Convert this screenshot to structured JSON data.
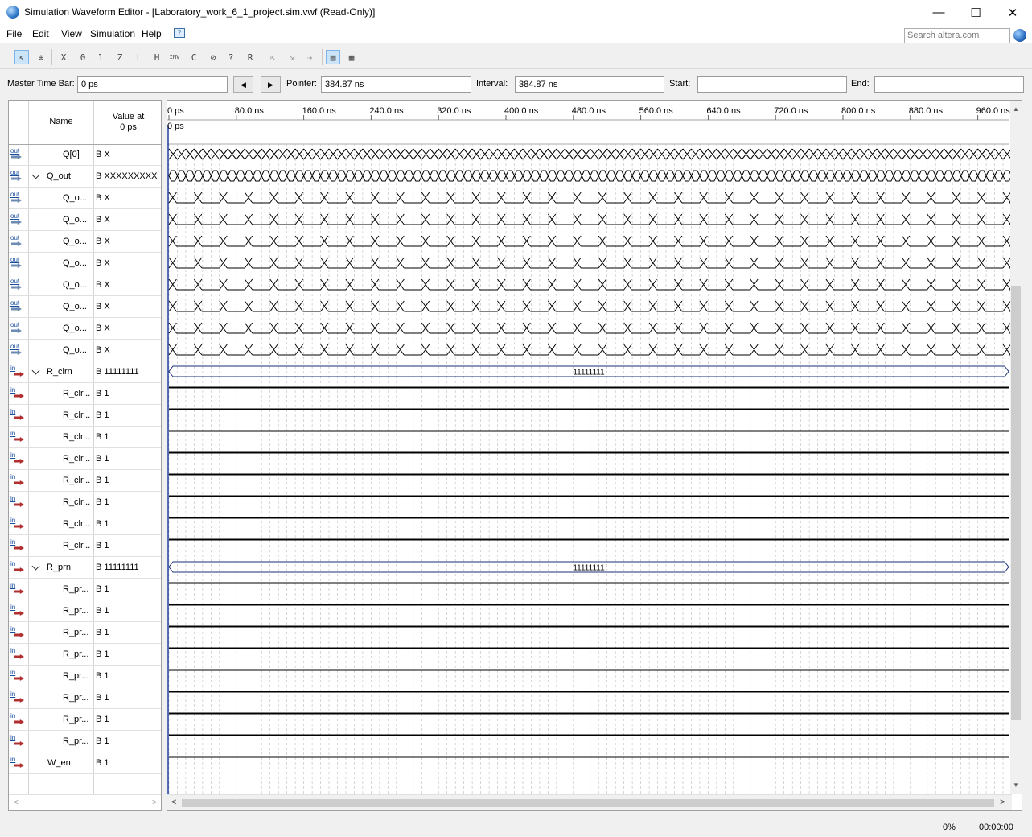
{
  "window": {
    "title": "Simulation Waveform Editor - [Laboratory_work_6_1_project.sim.vwf (Read-Only)]",
    "minimize": "—",
    "maximize": "☐",
    "close": "✕"
  },
  "menu": {
    "items": [
      "File",
      "Edit",
      "View",
      "Simulation",
      "Help"
    ]
  },
  "search": {
    "placeholder": "Search altera.com"
  },
  "toolbar": {
    "icons": [
      "selection-tool",
      "zoom-tool",
      "forcing-unknown",
      "forcing-low",
      "forcing-high",
      "high-impedance",
      "weak-low",
      "weak-high",
      "invert",
      "count-value",
      "clock",
      "random-values",
      "dont-care",
      "overwrite-clock",
      "snap-to-grid",
      "sort",
      "rearrange",
      "grid-view",
      "group"
    ]
  },
  "timebar": {
    "master_label": "Master Time Bar:",
    "master_value": "0 ps",
    "pointer_label": "Pointer:",
    "pointer_value": "384.87 ns",
    "interval_label": "Interval:",
    "interval_value": "384.87 ns",
    "start_label": "Start:",
    "start_value": "",
    "end_label": "End:",
    "end_value": ""
  },
  "columns": {
    "name": "Name",
    "value_line1": "Value at",
    "value_line2": "0 ps"
  },
  "ruler": {
    "labels": [
      "0 ps",
      "80.0 ns",
      "160.0 ns",
      "240.0 ns",
      "320.0 ns",
      "400.0 ns",
      "480.0 ns",
      "560.0 ns",
      "640.0 ns",
      "720.0 ns",
      "800.0 ns",
      "880.0 ns",
      "960.0 ns"
    ],
    "master_marker": "0 ps"
  },
  "signals": [
    {
      "dir": "out",
      "name": "Q[0]",
      "value": "B X",
      "group": false,
      "indent": false,
      "wave": "xfast"
    },
    {
      "dir": "out",
      "name": "Q_out",
      "value": "B XXXXXXXXX",
      "group": true,
      "indent": false,
      "wave": "bus"
    },
    {
      "dir": "out",
      "name": "Q_o...",
      "value": "B X",
      "group": false,
      "indent": true,
      "wave": "pattern"
    },
    {
      "dir": "out",
      "name": "Q_o...",
      "value": "B X",
      "group": false,
      "indent": true,
      "wave": "pattern"
    },
    {
      "dir": "out",
      "name": "Q_o...",
      "value": "B X",
      "group": false,
      "indent": true,
      "wave": "pattern"
    },
    {
      "dir": "out",
      "name": "Q_o...",
      "value": "B X",
      "group": false,
      "indent": true,
      "wave": "pattern"
    },
    {
      "dir": "out",
      "name": "Q_o...",
      "value": "B X",
      "group": false,
      "indent": true,
      "wave": "pattern"
    },
    {
      "dir": "out",
      "name": "Q_o...",
      "value": "B X",
      "group": false,
      "indent": true,
      "wave": "pattern"
    },
    {
      "dir": "out",
      "name": "Q_o...",
      "value": "B X",
      "group": false,
      "indent": true,
      "wave": "pattern"
    },
    {
      "dir": "out",
      "name": "Q_o...",
      "value": "B X",
      "group": false,
      "indent": true,
      "wave": "pattern"
    },
    {
      "dir": "in",
      "name": "R_clrn",
      "value": "B 11111111",
      "group": true,
      "indent": false,
      "wave": "busconst",
      "bus_label": "11111111"
    },
    {
      "dir": "in",
      "name": "R_clr...",
      "value": "B 1",
      "group": false,
      "indent": true,
      "wave": "high"
    },
    {
      "dir": "in",
      "name": "R_clr...",
      "value": "B 1",
      "group": false,
      "indent": true,
      "wave": "high"
    },
    {
      "dir": "in",
      "name": "R_clr...",
      "value": "B 1",
      "group": false,
      "indent": true,
      "wave": "high"
    },
    {
      "dir": "in",
      "name": "R_clr...",
      "value": "B 1",
      "group": false,
      "indent": true,
      "wave": "high"
    },
    {
      "dir": "in",
      "name": "R_clr...",
      "value": "B 1",
      "group": false,
      "indent": true,
      "wave": "high"
    },
    {
      "dir": "in",
      "name": "R_clr...",
      "value": "B 1",
      "group": false,
      "indent": true,
      "wave": "high"
    },
    {
      "dir": "in",
      "name": "R_clr...",
      "value": "B 1",
      "group": false,
      "indent": true,
      "wave": "high"
    },
    {
      "dir": "in",
      "name": "R_clr...",
      "value": "B 1",
      "group": false,
      "indent": true,
      "wave": "high"
    },
    {
      "dir": "in",
      "name": "R_prn",
      "value": "B 11111111",
      "group": true,
      "indent": false,
      "wave": "busconst",
      "bus_label": "11111111"
    },
    {
      "dir": "in",
      "name": "R_pr...",
      "value": "B 1",
      "group": false,
      "indent": true,
      "wave": "high"
    },
    {
      "dir": "in",
      "name": "R_pr...",
      "value": "B 1",
      "group": false,
      "indent": true,
      "wave": "high"
    },
    {
      "dir": "in",
      "name": "R_pr...",
      "value": "B 1",
      "group": false,
      "indent": true,
      "wave": "high"
    },
    {
      "dir": "in",
      "name": "R_pr...",
      "value": "B 1",
      "group": false,
      "indent": true,
      "wave": "high"
    },
    {
      "dir": "in",
      "name": "R_pr...",
      "value": "B 1",
      "group": false,
      "indent": true,
      "wave": "high"
    },
    {
      "dir": "in",
      "name": "R_pr...",
      "value": "B 1",
      "group": false,
      "indent": true,
      "wave": "high"
    },
    {
      "dir": "in",
      "name": "R_pr...",
      "value": "B 1",
      "group": false,
      "indent": true,
      "wave": "high"
    },
    {
      "dir": "in",
      "name": "R_pr...",
      "value": "B 1",
      "group": false,
      "indent": true,
      "wave": "high"
    },
    {
      "dir": "in",
      "name": "W_en",
      "value": "B 1",
      "group": false,
      "indent": false,
      "wave": "high"
    }
  ],
  "status": {
    "progress": "0%",
    "elapsed": "00:00:00"
  },
  "colors": {
    "accent": "#0078d7",
    "wave": "#000000",
    "grid": "#bcbcbc"
  }
}
